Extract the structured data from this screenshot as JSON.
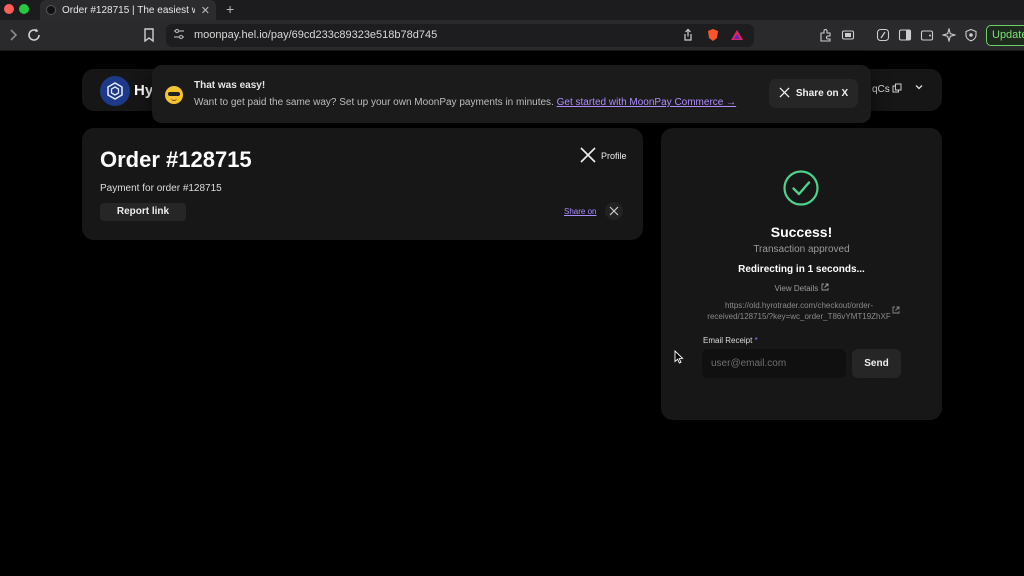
{
  "browser": {
    "tab_title": "Order #128715 | The easiest w",
    "tab_close": "✕",
    "new_tab": "+",
    "url": "moonpay.hel.io/pay/69cd233c89323e518b78d745",
    "update_label": "Update"
  },
  "header": {
    "logo_text": "Hy",
    "wallet_short": "qCs"
  },
  "toast": {
    "title": "That was easy!",
    "body": "Want to get paid the same way? Set up your own MoonPay payments in minutes.",
    "link": "Get started with MoonPay Commerce →",
    "share_label": "Share on X"
  },
  "order": {
    "title": "Order #128715",
    "description": "Payment for order #128715",
    "report_label": "Report link",
    "profile_label": "Profile",
    "share_on_label": "Share on"
  },
  "success": {
    "title": "Success!",
    "subtitle": "Transaction approved",
    "redirect_text": "Redirecting in 1 seconds...",
    "view_details": "View Details",
    "redirect_url": "https://old.hyrotrader.com/checkout/order-received/128715/?key=wc_order_T86vYMT19ZhXF",
    "email_label": "Email Receipt",
    "email_required": "*",
    "email_placeholder": "user@email.com",
    "send_label": "Send"
  },
  "colors": {
    "accent_purple": "#a98cff",
    "success_green": "#4fd18b",
    "update_green": "#6ccf6a"
  }
}
